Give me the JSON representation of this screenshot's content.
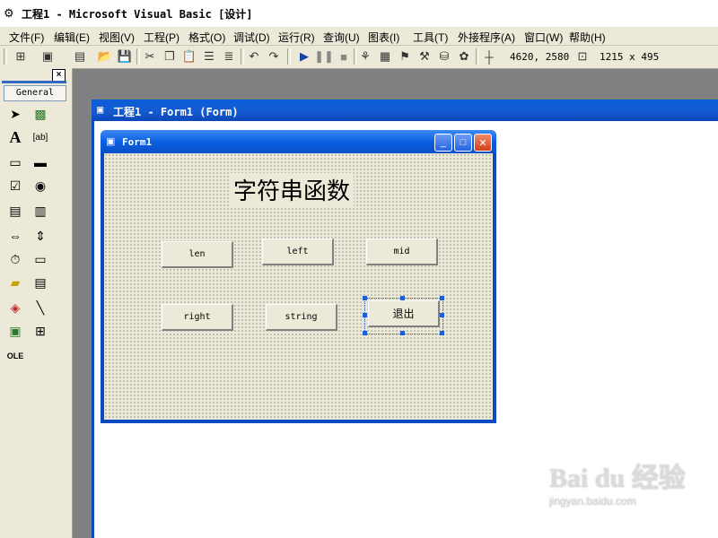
{
  "app": {
    "title": "工程1 - Microsoft Visual Basic [设计]"
  },
  "menu": [
    "文件(F)",
    "编辑(E)",
    "视图(V)",
    "工程(P)",
    "格式(O)",
    "调试(D)",
    "运行(R)",
    "查询(U)",
    "图表(I)",
    "工具(T)",
    "外接程序(A)",
    "窗口(W)",
    "帮助(H)"
  ],
  "toolbar": {
    "position": "4620, 2580",
    "size": "1215 x 495"
  },
  "toolbox": {
    "tab_label": "General",
    "close_label": "×"
  },
  "designer": {
    "title": "工程1 - Form1 (Form)"
  },
  "form": {
    "title": "Form1",
    "label_caption": "字符串函数",
    "buttons": {
      "len": "len",
      "left": "left",
      "mid": "mid",
      "right": "right",
      "string": "string",
      "exit": "退出"
    }
  },
  "watermark": {
    "brand": "Bai du 经验",
    "url": "jingyan.baidu.com"
  },
  "colors": {
    "titlebar_blue": "#0a5fd9",
    "face": "#ece9d8",
    "selection": "#1c5fd6"
  }
}
